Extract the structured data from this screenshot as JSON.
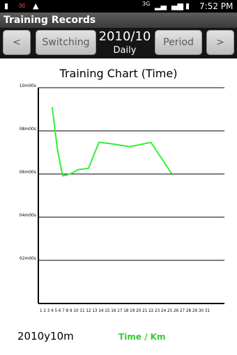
{
  "status": {
    "time": "7:52 PM",
    "network": "3G"
  },
  "app": {
    "title": "Training Records"
  },
  "toolbar": {
    "prev_label": "<",
    "switching_label": "Switching",
    "period_value": "2010/10",
    "period_mode": "Daily",
    "period_label": "Period",
    "next_label": ">"
  },
  "chart_data": {
    "type": "line",
    "title": "Training Chart (Time)",
    "y_ticks": [
      "10m00s",
      "08m00s",
      "06m00s",
      "04m00s",
      "02m00s"
    ],
    "y_tick_values": [
      600,
      480,
      360,
      240,
      120
    ],
    "ylim": [
      0,
      600
    ],
    "x_categories": [
      "1",
      "2",
      "3",
      "4",
      "5",
      "6",
      "7",
      "8",
      "9",
      "10",
      "11",
      "12",
      "13",
      "14",
      "15",
      "16",
      "17",
      "18",
      "19",
      "20",
      "21",
      "22",
      "23",
      "24",
      "25",
      "26",
      "27",
      "28",
      "29",
      "30",
      "31"
    ],
    "x_tick_text": "1 2 3 4 5 6 7 8 9 10 11 12 13 14 15 16 17 18 19 20 21 22 23 24 25 26 27 28 29 30 31",
    "series": [
      {
        "name": "Time / Km",
        "color": "#33ee33",
        "points": [
          {
            "x": 3,
            "y": 546
          },
          {
            "x": 4,
            "y": 430
          },
          {
            "x": 5,
            "y": 355
          },
          {
            "x": 6,
            "y": 358
          },
          {
            "x": 7,
            "y": 364
          },
          {
            "x": 8,
            "y": 372
          },
          {
            "x": 10,
            "y": 376
          },
          {
            "x": 12,
            "y": 448
          },
          {
            "x": 14,
            "y": 445
          },
          {
            "x": 18,
            "y": 436
          },
          {
            "x": 22,
            "y": 448
          },
          {
            "x": 26,
            "y": 361
          }
        ]
      }
    ]
  },
  "footer": {
    "date_label": "2010y10m",
    "legend_label": "Time / Km"
  }
}
